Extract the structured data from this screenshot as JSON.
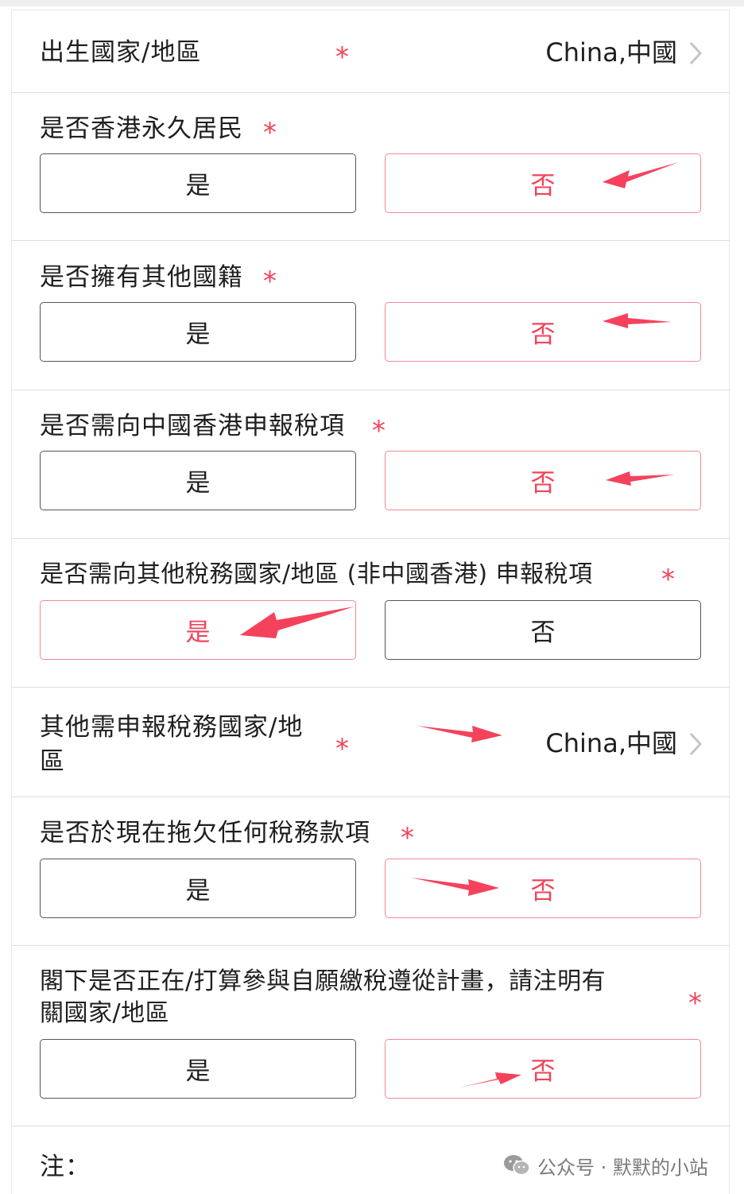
{
  "rows": [
    {
      "label": "出生國家/地區",
      "value": "China,中國"
    },
    {
      "label": "是否香港永久居民",
      "yes": "是",
      "no": "否",
      "selected": "no"
    },
    {
      "label": "是否擁有其他國籍",
      "yes": "是",
      "no": "否",
      "selected": "no"
    },
    {
      "label": "是否需向中國香港申報稅項",
      "yes": "是",
      "no": "否",
      "selected": "no"
    },
    {
      "label": "是否需向其他稅務國家/地區 (非中國香港) 申報稅項",
      "yes": "是",
      "no": "否",
      "selected": "yes"
    },
    {
      "label_line1": "其他需申報稅務國家/地",
      "label_line2": "區",
      "value": "China,中國"
    },
    {
      "label": "是否於現在拖欠任何稅務款項",
      "yes": "是",
      "no": "否",
      "selected": "no"
    },
    {
      "label_line1": "閣下是否正在/打算參與自願繳稅遵從計畫，請注明有",
      "label_line2": "關國家/地區",
      "yes": "是",
      "no": "否",
      "selected": "no"
    }
  ],
  "required_mark": "*",
  "note_label": "注：",
  "watermark": {
    "icon": "wechat-icon",
    "text": "公众号 · 默默的小站"
  },
  "colors": {
    "accent": "#f0445a",
    "selected_border": "#f08a95",
    "arrow": "#f5425c"
  }
}
